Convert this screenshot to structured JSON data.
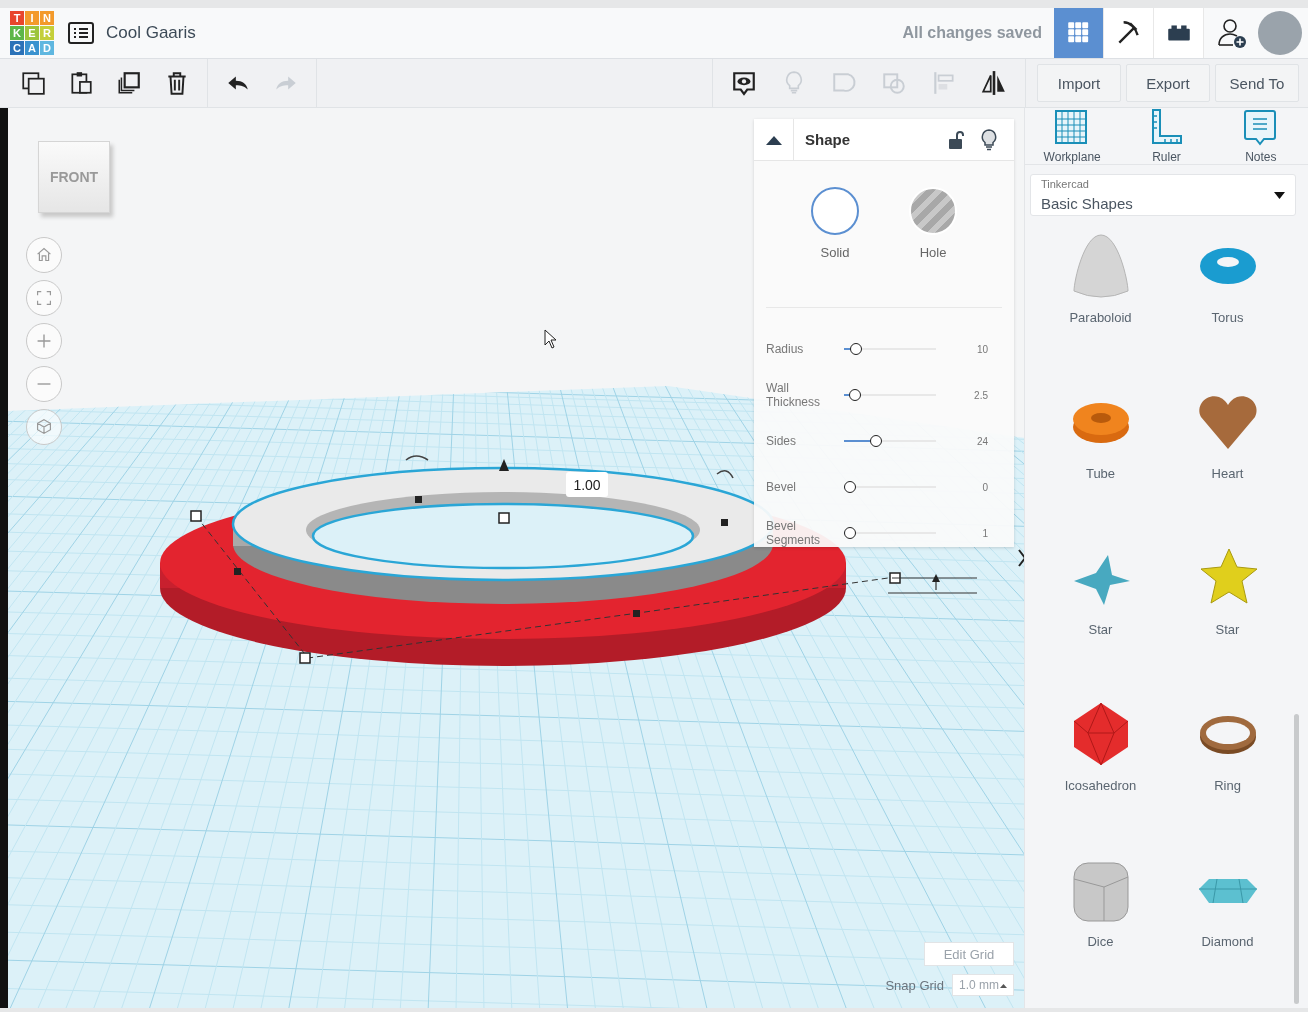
{
  "header": {
    "logo_letters": [
      "T",
      "I",
      "N",
      "K",
      "E",
      "R",
      "C",
      "A",
      "D"
    ],
    "title": "Cool Gaaris",
    "save_status": "All changes saved",
    "views": [
      {
        "kind": "grid",
        "selected": true
      },
      {
        "kind": "pickaxe",
        "selected": false
      },
      {
        "kind": "brick",
        "selected": false
      }
    ]
  },
  "toolbar": {
    "edit_tools": [
      {
        "kind": "copy",
        "disabled": false
      },
      {
        "kind": "paste",
        "disabled": false
      },
      {
        "kind": "duplicate",
        "disabled": false
      },
      {
        "kind": "delete",
        "disabled": false
      },
      {
        "kind": "undo",
        "disabled": false
      },
      {
        "kind": "redo",
        "disabled": true
      }
    ],
    "shape_tools": [
      {
        "kind": "note",
        "disabled": false
      },
      {
        "kind": "bulb",
        "disabled": true
      },
      {
        "kind": "group",
        "disabled": true
      },
      {
        "kind": "ungroup",
        "disabled": true
      },
      {
        "kind": "align",
        "disabled": true
      },
      {
        "kind": "mirror",
        "disabled": false
      }
    ],
    "buttons": [
      "Import",
      "Export",
      "Send To"
    ]
  },
  "workspace": {
    "view_cube": "FRONT",
    "view_controls": [
      {
        "kind": "home"
      },
      {
        "kind": "fit"
      },
      {
        "kind": "zoom-in"
      },
      {
        "kind": "zoom-out"
      },
      {
        "kind": "perspective"
      }
    ],
    "dimension": "1.00",
    "edit_grid": "Edit Grid",
    "snap_grid": {
      "label": "Snap Grid",
      "value": "1.0 mm"
    }
  },
  "shape_panel": {
    "title": "Shape",
    "modes": [
      {
        "label": "Solid",
        "selected": true
      },
      {
        "label": "Hole",
        "selected": false
      }
    ],
    "params": [
      {
        "label": "Radius",
        "level": 0.08,
        "reading": "10"
      },
      {
        "label": "Wall Thickness",
        "level": 0.06,
        "reading": "2.5"
      },
      {
        "label": "Sides",
        "level": 0.33,
        "reading": "24"
      },
      {
        "label": "Bevel",
        "level": 0,
        "reading": "0"
      },
      {
        "label": "Bevel Segments",
        "level": 0,
        "reading": "1"
      }
    ]
  },
  "sidebar": {
    "tools": [
      {
        "kind": "workplane",
        "label": "Workplane"
      },
      {
        "kind": "ruler",
        "label": "Ruler"
      },
      {
        "kind": "notes",
        "label": "Notes"
      }
    ],
    "library": {
      "caption": "Tinkercad",
      "value": "Basic Shapes"
    },
    "shapes": [
      {
        "kind": "paraboloid",
        "label": "Paraboloid"
      },
      {
        "kind": "torus",
        "label": "Torus"
      },
      {
        "kind": "tube",
        "label": "Tube"
      },
      {
        "kind": "heart",
        "label": "Heart"
      },
      {
        "kind": "star-teal",
        "label": "Star"
      },
      {
        "kind": "star-yellow",
        "label": "Star"
      },
      {
        "kind": "icosahedron",
        "label": "Icosahedron"
      },
      {
        "kind": "ring",
        "label": "Ring"
      },
      {
        "kind": "dice",
        "label": "Dice"
      },
      {
        "kind": "diamond",
        "label": "Diamond"
      }
    ]
  }
}
